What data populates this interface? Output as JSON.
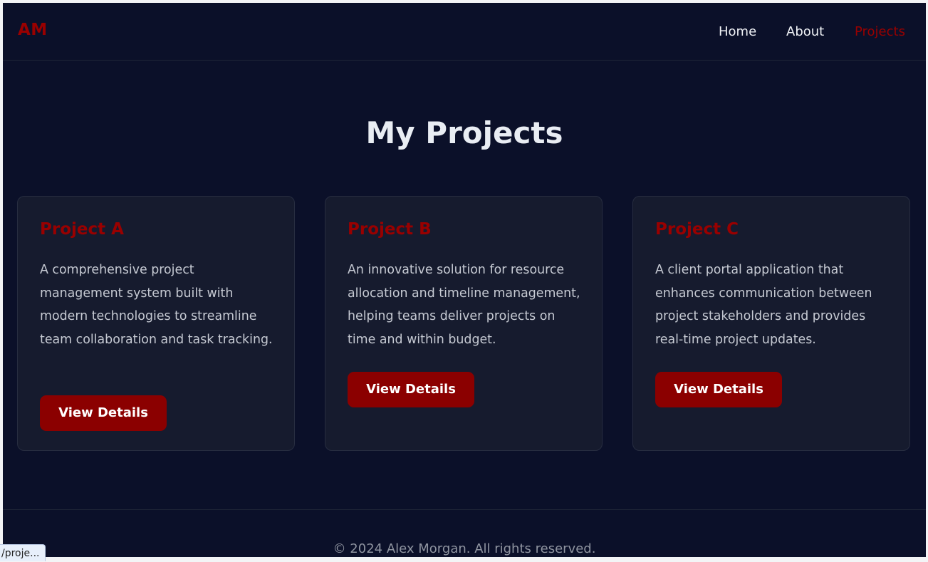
{
  "header": {
    "logo": "AM",
    "nav": [
      {
        "label": "Home"
      },
      {
        "label": "About"
      },
      {
        "label": "Projects",
        "active": true
      }
    ]
  },
  "main": {
    "title": "My Projects",
    "projects": [
      {
        "title": "Project A",
        "description": "A comprehensive project management system built with modern technologies to streamline team collaboration and task tracking.",
        "button_label": "View Details"
      },
      {
        "title": "Project B",
        "description": "An innovative solution for resource allocation and timeline management, helping teams deliver projects on time and within budget.",
        "button_label": "View Details"
      },
      {
        "title": "Project C",
        "description": "A client portal application that enhances communication between project stakeholders and provides real-time project updates.",
        "button_label": "View Details"
      }
    ]
  },
  "footer": {
    "copyright": "© 2024 Alex Morgan. All rights reserved."
  },
  "status_bar": {
    "url": "/proje..."
  },
  "colors": {
    "background": "#0b1029",
    "card": "#161b2e",
    "accent": "#990000",
    "button": "#8b0000",
    "text": "#e9edf3"
  }
}
